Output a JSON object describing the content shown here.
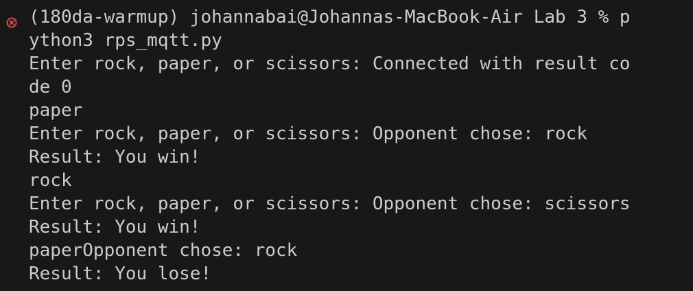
{
  "terminal": {
    "status_icon": "error-circle-x-icon",
    "status_color": "#f14c4c",
    "background": "#181818",
    "foreground": "#cccccc",
    "lines": [
      "(180da-warmup) johannabai@Johannas-MacBook-Air Lab 3 % p",
      "ython3 rps_mqtt.py",
      "Enter rock, paper, or scissors: Connected with result co",
      "de 0",
      "paper",
      "Enter rock, paper, or scissors: Opponent chose: rock",
      "Result: You win!",
      "rock",
      "Enter rock, paper, or scissors: Opponent chose: scissors",
      "Result: You win!",
      "paperOpponent chose: rock",
      "Result: You lose!"
    ]
  }
}
